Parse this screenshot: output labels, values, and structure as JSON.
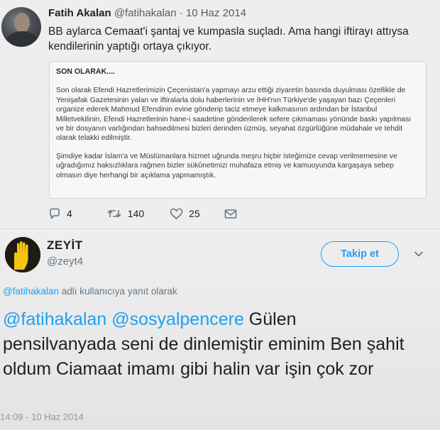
{
  "quoted_tweet": {
    "author_name": "Fatih Akalan",
    "author_handle": "@fatihakalan",
    "separator": "·",
    "date": "10 Haz 2014",
    "text": "BB aylarca Cemaat'i şantaj ve kumpasla suçladı. Ama hangi iftirayı attıysa kendilerinin yaptığı ortaya çıkıyor.",
    "card": {
      "title": "SON OLARAK....",
      "paragraph_1": "Son olarak Efendi Hazretlerimizin Çeçenistan'a yapmayı arzu ettiği ziyaretin basında duyulması özellikle de Yenişafak Gazetesinin yalan ve iftiralarla dolu haberlerinin ve İHH'nın Türkiye'de yaşayan bazı Çeçenleri organize ederek Mahmud Efendinin evine gönderip taciz etmeye kalkmasının ardından bir İstanbul Milletvekilinin, Efendi Hazretlerinin hane-i saadetine gönderilerek sefere çıkmaması yönünde baskı yapılması ve bir dosyanın varlığından bahsedilmesi bizleri derinden üzmüş, seyahat özgürlüğüne müdahale ve tehdit olarak telakki edilmiştir.",
      "paragraph_2": "Şimdiye kadar İslam'a ve Müslümanlara hizmet uğrunda meşru hiçbir isteğimize cevap verilmemesine ve uğradığımız haksızlıklara rağmen bizler sükûnetimizi muhafaza etmiş ve kamuoyunda kargaşaya sebep olmasın diye herhangi bir açıklama yapmamıştık."
    },
    "actions": {
      "reply_count": "4",
      "retweet_count": "140",
      "like_count": "25"
    }
  },
  "main_tweet": {
    "author_name": "ZEYİT",
    "author_handle": "@zeyt4",
    "follow_label": "Takip et",
    "reply_to_mention": "@fatihakalan",
    "reply_to_suffix": " adlı kullanıcıya yanıt olarak",
    "mention_1": "@fatihakalan",
    "mention_2": "@sosyalpencere",
    "body": " Gülen pensilvanyada seni de dinlemiştir eminim Ben şahit oldum Ciamaat imamı gibi halin var işin çok zor",
    "timestamp": "14:09 - 10 Haz 2014"
  },
  "icons": {
    "reply": "reply-icon",
    "retweet": "retweet-icon",
    "like": "heart-icon",
    "dm": "envelope-icon",
    "caret": "chevron-down-icon",
    "avatar_symbol": "rabia-hand-icon"
  },
  "colors": {
    "accent": "#1da1f2",
    "text": "#1c2022",
    "muted": "#657786",
    "avatar_yellow": "#f3c510"
  }
}
